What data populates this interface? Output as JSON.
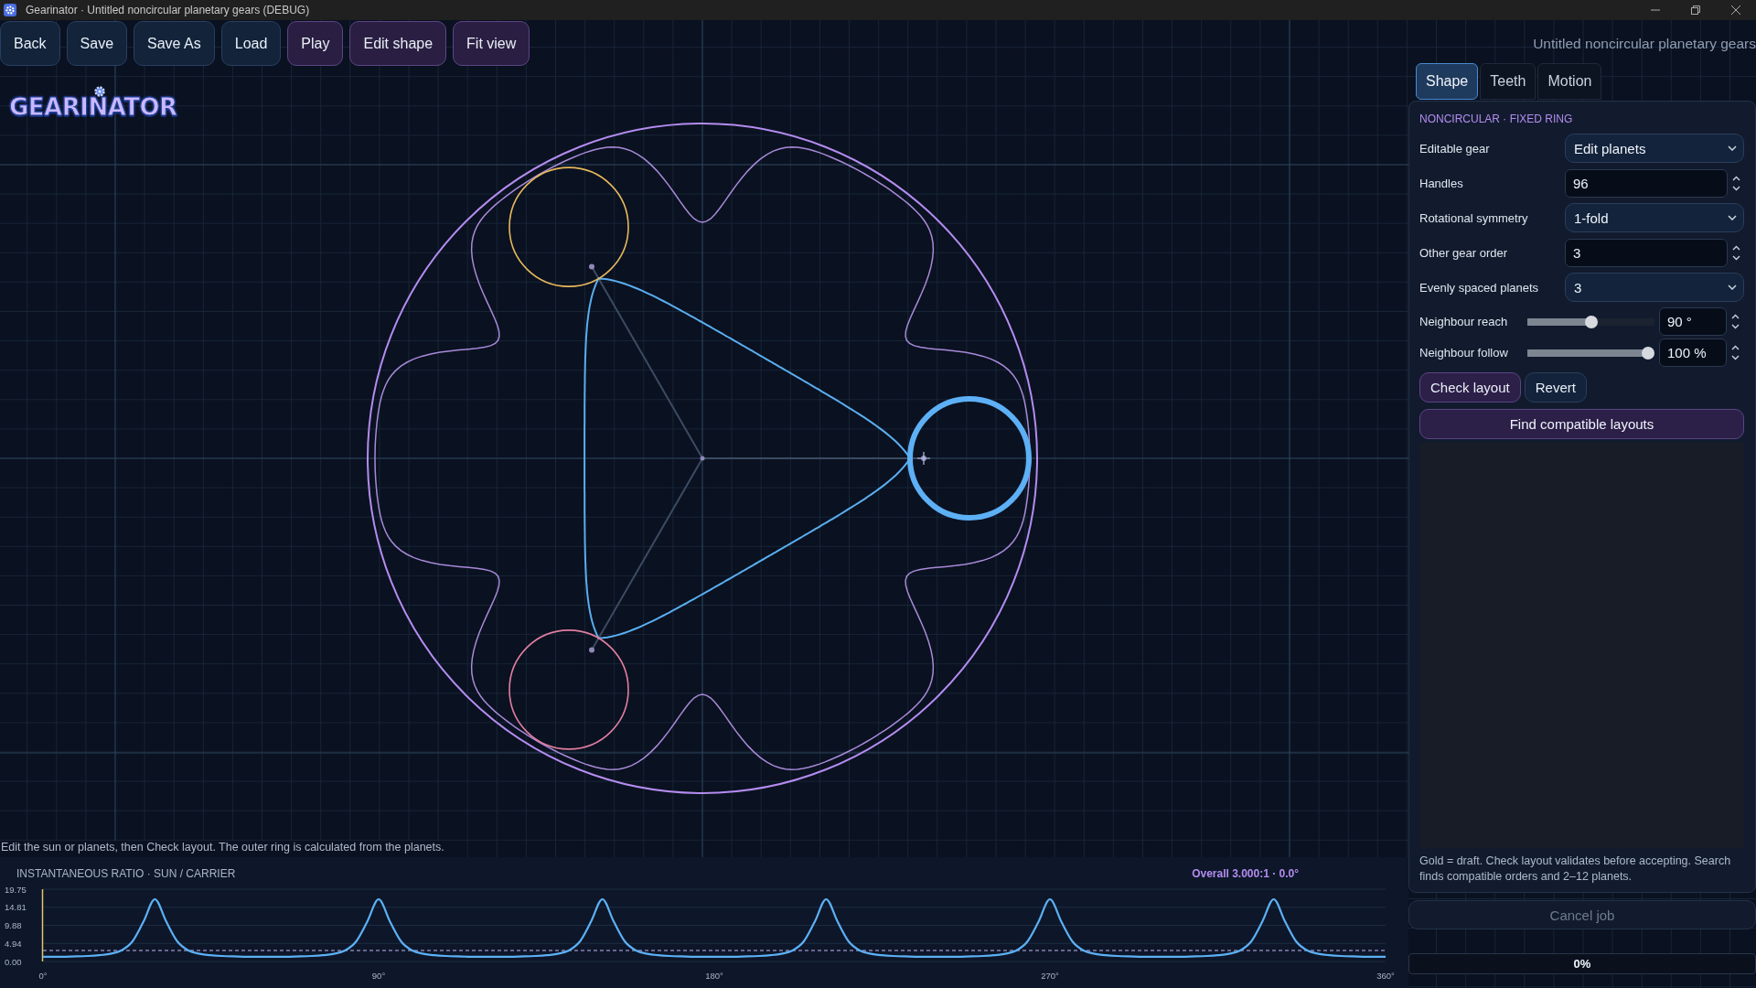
{
  "window": {
    "title": "Gearinator · Untitled noncircular planetary gears (DEBUG)"
  },
  "toolbar": [
    {
      "label": "Back",
      "kind": "file"
    },
    {
      "label": "Save",
      "kind": "file"
    },
    {
      "label": "Save As",
      "kind": "file"
    },
    {
      "label": "Load",
      "kind": "file"
    },
    {
      "label": "Play",
      "kind": "view"
    },
    {
      "label": "Edit shape",
      "kind": "view"
    },
    {
      "label": "Fit view",
      "kind": "view"
    }
  ],
  "logo": {
    "text": "GEARINATOR"
  },
  "document_title": "Untitled noncircular planetary gears",
  "tabs": [
    {
      "label": "Shape",
      "selected": true
    },
    {
      "label": "Teeth",
      "selected": false
    },
    {
      "label": "Motion",
      "selected": false
    }
  ],
  "panel": {
    "section": "NONCIRCULAR · FIXED RING",
    "fields": [
      {
        "label": "Editable gear",
        "kind": "select",
        "value": "Edit planets"
      },
      {
        "label": "Handles",
        "kind": "number",
        "value": "96"
      },
      {
        "label": "Rotational symmetry",
        "kind": "select",
        "value": "1-fold"
      },
      {
        "label": "Other gear order",
        "kind": "number",
        "value": "3"
      },
      {
        "label": "Evenly spaced planets",
        "kind": "select",
        "value": "3"
      },
      {
        "label": "Neighbour reach",
        "kind": "slider",
        "level": 0.5,
        "value": "90 °"
      },
      {
        "label": "Neighbour follow",
        "kind": "slider",
        "level": 1,
        "value": "100 %"
      }
    ],
    "buttons": [
      {
        "label": "Check layout",
        "kind": "accent"
      },
      {
        "label": "Revert",
        "kind": "plain"
      }
    ],
    "search_button": "Find compatible layouts",
    "help": "Gold = draft. Check layout validates before accepting. Search finds compatible orders and 2–12 planets."
  },
  "cancel_button": {
    "label": "Cancel job",
    "disabled": true
  },
  "progress": {
    "level": 0,
    "text": "0%"
  },
  "canvas": {
    "planets": [
      {
        "color": "#5db0f5",
        "selected": true
      },
      {
        "color": "#e6b85c",
        "selected": false
      },
      {
        "color": "#e07ea0",
        "selected": false
      }
    ]
  },
  "status": "Edit the sun or planets, then Check layout. The outer ring is calculated from the planets.",
  "ratio_panel": {
    "title": "INSTANTANEOUS RATIO · SUN / CARRIER",
    "readout": "Overall 3.000:1 · 0.0°",
    "chart_data": {
      "type": "line",
      "xlim": [
        0,
        360
      ],
      "ylim": [
        0,
        19.75
      ],
      "xticks": [
        {
          "value": 0,
          "label": "0°"
        },
        {
          "value": 90,
          "label": "90°"
        },
        {
          "value": 180,
          "label": "180°"
        },
        {
          "value": 270,
          "label": "270°"
        },
        {
          "value": 360,
          "label": "360°"
        }
      ],
      "yticks": [
        {
          "value": 0,
          "label": "0.00"
        },
        {
          "value": 4.94,
          "label": "4.94"
        },
        {
          "value": 9.88,
          "label": "9.88"
        },
        {
          "value": 14.81,
          "label": "14.81"
        },
        {
          "value": 19.75,
          "label": "19.75"
        }
      ],
      "x": [
        0,
        3,
        6,
        9,
        12,
        15,
        18,
        21,
        24,
        27,
        30,
        33,
        36,
        39,
        42,
        45,
        48,
        51,
        54,
        57,
        60,
        63,
        66,
        69,
        72,
        75,
        78,
        81,
        84,
        87,
        90,
        93,
        96,
        99,
        102,
        105,
        108,
        111,
        114,
        117,
        120,
        123,
        126,
        129,
        132,
        135,
        138,
        141,
        144,
        147,
        150,
        153,
        156,
        159,
        162,
        165,
        168,
        171,
        174,
        177,
        180,
        183,
        186,
        189,
        192,
        195,
        198,
        201,
        204,
        207,
        210,
        213,
        216,
        219,
        222,
        225,
        228,
        231,
        234,
        237,
        240,
        243,
        246,
        249,
        252,
        255,
        258,
        261,
        264,
        267,
        270,
        273,
        276,
        279,
        282,
        285,
        288,
        291,
        294,
        297,
        300,
        303,
        306,
        309,
        312,
        315,
        318,
        321,
        324,
        327,
        330,
        333,
        336,
        339,
        342,
        345,
        348,
        351,
        354,
        357,
        360
      ],
      "series": [
        {
          "color": "#5db0f5",
          "values": [
            1.3,
            1.3,
            1.3,
            1.4,
            1.5,
            1.7,
            2.1,
            3.0,
            5.5,
            11.0,
            17.0,
            11.0,
            5.5,
            3.0,
            2.1,
            1.7,
            1.5,
            1.4,
            1.3,
            1.3,
            1.3,
            1.3,
            1.3,
            1.4,
            1.5,
            1.7,
            2.1,
            3.0,
            5.5,
            11.0,
            17.0,
            11.0,
            5.5,
            3.0,
            2.1,
            1.7,
            1.5,
            1.4,
            1.3,
            1.3,
            1.3,
            1.3,
            1.3,
            1.4,
            1.5,
            1.7,
            2.1,
            3.0,
            5.5,
            11.0,
            17.0,
            11.0,
            5.5,
            3.0,
            2.1,
            1.7,
            1.5,
            1.4,
            1.3,
            1.3,
            1.3,
            1.3,
            1.3,
            1.4,
            1.5,
            1.7,
            2.1,
            3.0,
            5.5,
            11.0,
            17.0,
            11.0,
            5.5,
            3.0,
            2.1,
            1.7,
            1.5,
            1.4,
            1.3,
            1.3,
            1.3,
            1.3,
            1.3,
            1.4,
            1.5,
            1.7,
            2.1,
            3.0,
            5.5,
            11.0,
            17.0,
            11.0,
            5.5,
            3.0,
            2.1,
            1.7,
            1.5,
            1.4,
            1.3,
            1.3,
            1.3,
            1.3,
            1.3,
            1.4,
            1.5,
            1.7,
            2.1,
            3.0,
            5.5,
            11.0,
            17.0,
            11.0,
            5.5,
            3.0,
            2.1,
            1.7,
            1.5,
            1.4,
            1.3,
            1.3,
            1.3
          ]
        }
      ],
      "grid": true,
      "ref_lines": [
        {
          "axis": "y",
          "value": 3
        }
      ]
    }
  }
}
